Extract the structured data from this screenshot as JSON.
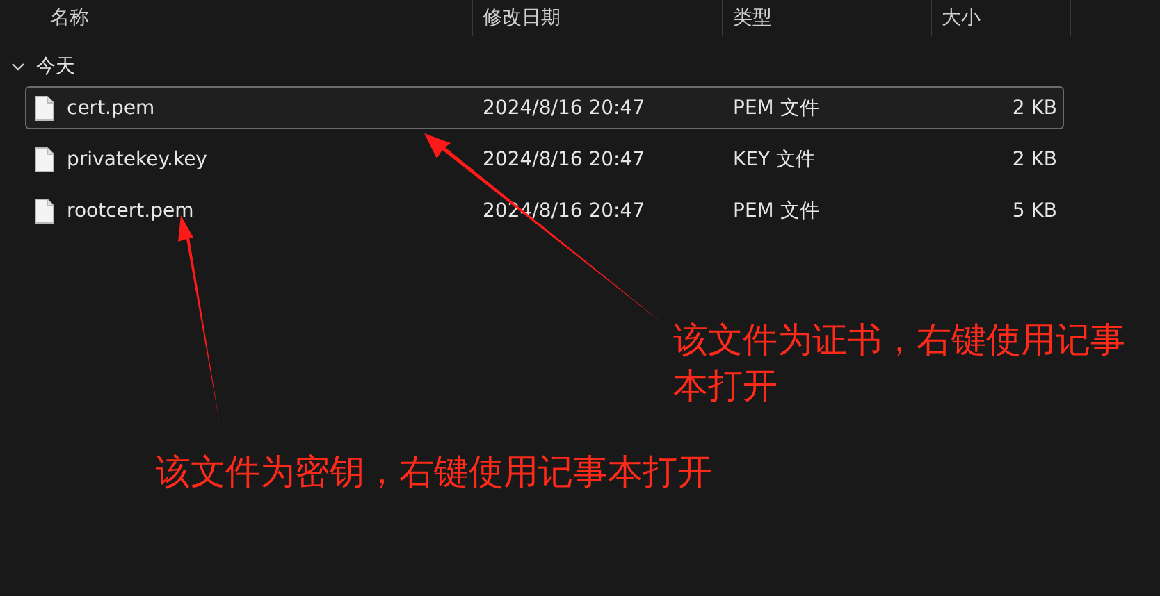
{
  "columns": [
    "名称",
    "修改日期",
    "类型",
    "大小"
  ],
  "group": {
    "label": "今天",
    "expanded": true
  },
  "files": [
    {
      "name": "cert.pem",
      "modified": "2024/8/16 20:47",
      "type": "PEM 文件",
      "size": "2 KB",
      "selected": true
    },
    {
      "name": "privatekey.key",
      "modified": "2024/8/16 20:47",
      "type": "KEY 文件",
      "size": "2 KB",
      "selected": false
    },
    {
      "name": "rootcert.pem",
      "modified": "2024/8/16 20:47",
      "type": "PEM 文件",
      "size": "5 KB",
      "selected": false
    }
  ],
  "annotations": [
    "该文件为证书，右键使用记事本打开",
    "该文件为密钥，右键使用记事本打开"
  ]
}
